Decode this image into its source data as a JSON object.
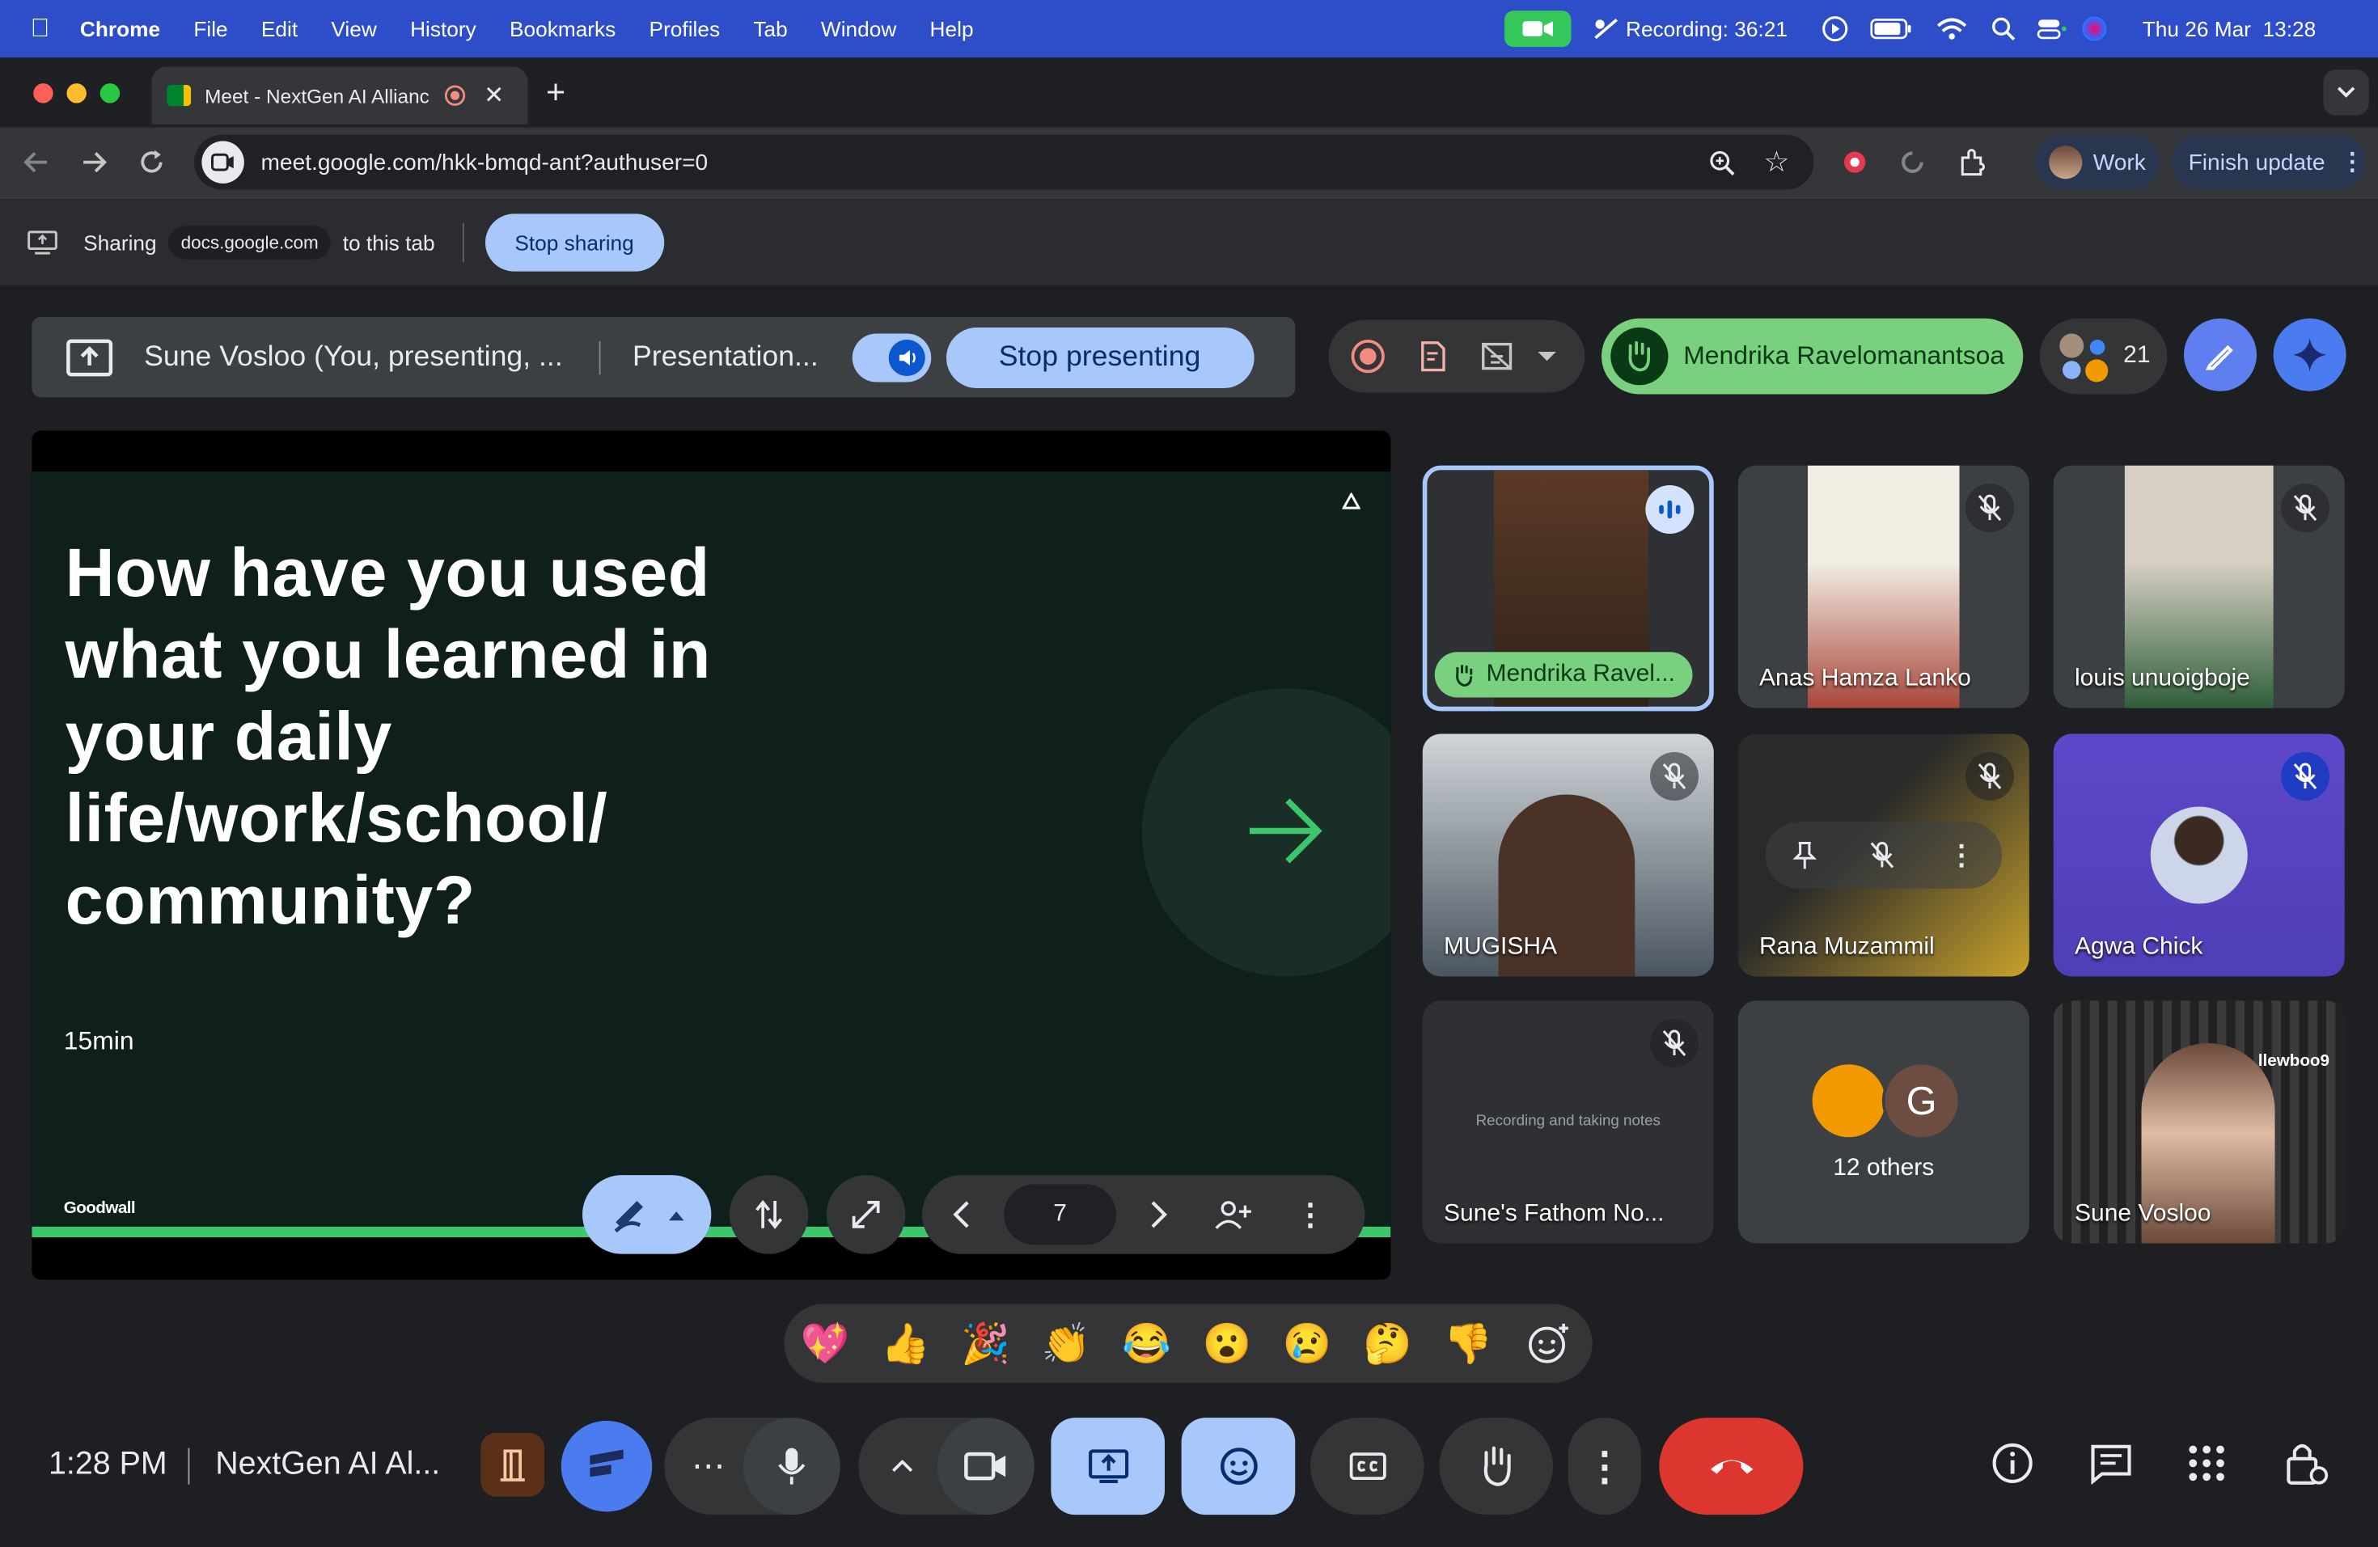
{
  "menubar": {
    "app": "Chrome",
    "items": [
      "File",
      "Edit",
      "View",
      "History",
      "Bookmarks",
      "Profiles",
      "Tab",
      "Window",
      "Help"
    ],
    "recording": "Recording: 36:21",
    "datetime": "Thu 26 Mar  13:28"
  },
  "browser": {
    "tab_title": "Meet - NextGen AI Allianc",
    "url": "meet.google.com/hkk-bmqd-ant?authuser=0",
    "profile": "Work",
    "update_label": "Finish update"
  },
  "sharing": {
    "label": "Sharing",
    "domain": "docs.google.com",
    "suffix": "to this tab",
    "stop_label": "Stop sharing"
  },
  "presenting": {
    "presenter": "Sune Vosloo (You, presenting, ...",
    "source": "Presentation...",
    "stop_label": "Stop presenting"
  },
  "hand": {
    "name": "Mendrika Ravelomanantsoa"
  },
  "participants": {
    "count": "21"
  },
  "slide": {
    "question": "How have you used what you learned in your daily life/work/school/ community?",
    "duration": "15min",
    "brand": "Goodwall",
    "page": "7"
  },
  "tiles": [
    {
      "name": "Mendrika Ravel...",
      "colors": [
        "#5b3a26",
        "#2e2219"
      ]
    },
    {
      "name": "Anas Hamza Lanko",
      "colors": [
        "#f1ede3",
        "#a9463a"
      ]
    },
    {
      "name": "louis unuoigboje",
      "colors": [
        "#d7cfc3",
        "#2f5f3a"
      ]
    },
    {
      "name": "MUGISHA",
      "colors": [
        "#cfd5d8",
        "#4b5560"
      ]
    },
    {
      "name": "Rana Muzammil",
      "colors": [
        "#2a2a2a",
        "#c7a12b"
      ]
    },
    {
      "name": "Agwa Chick",
      "colors": [
        "#5e47c9",
        "#4e3fb6"
      ]
    },
    {
      "name": "Sune's Fathom No...",
      "caption": "Recording and taking notes"
    },
    {
      "name": "12 others",
      "initial": "G"
    },
    {
      "name": "Sune Vosloo",
      "overlay": "llewboo9"
    }
  ],
  "reactions": [
    "💖",
    "👍",
    "🎉",
    "👏",
    "😂",
    "😮",
    "😢",
    "🤔",
    "👎"
  ],
  "bottom": {
    "time": "1:28 PM",
    "meeting": "NextGen AI Al..."
  },
  "icons": {
    "mic_off": "mic-off-icon",
    "raise": "raise-hand-icon",
    "present": "present-icon"
  },
  "theme": {
    "accent": "#a8c7fa",
    "hand_green": "#79d17f",
    "end_red": "#dc362e",
    "slide_bg": "#0f1f1c",
    "slide_green": "#3ec66a"
  }
}
